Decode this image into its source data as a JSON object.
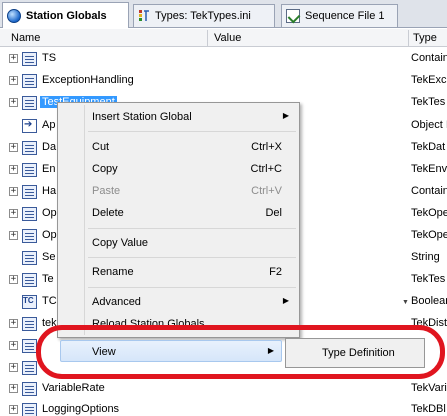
{
  "tabs": [
    {
      "label": "Station Globals",
      "icon": "globe-icon"
    },
    {
      "label": "Types: TekTypes.ini",
      "icon": "types-icon"
    },
    {
      "label": "Sequence File 1",
      "icon": "sequence-file-icon"
    }
  ],
  "columns": {
    "name": "Name",
    "value": "Value",
    "type": "Type"
  },
  "rows": [
    {
      "name": "TS",
      "type": "Contain"
    },
    {
      "name": "ExceptionHandling",
      "type": "TekExc"
    },
    {
      "name": "TestEquipment",
      "type": "TekTes"
    },
    {
      "name": "Ap",
      "type": "Object I"
    },
    {
      "name": "Da",
      "type": "TekDat"
    },
    {
      "name": "En",
      "type": "TekEnv"
    },
    {
      "name": "Ha",
      "type": "Contain"
    },
    {
      "name": "Op",
      "type": "TekOpe"
    },
    {
      "name": "Op",
      "type": "TekOpe"
    },
    {
      "name": "Se",
      "type": "String"
    },
    {
      "name": "Te",
      "type": "TekTes"
    },
    {
      "name": "TC",
      "type": "Boolear"
    },
    {
      "name": "tek",
      "type": "TekDist"
    },
    {
      "name": "",
      "type": ""
    },
    {
      "name": "",
      "type": ""
    },
    {
      "name": "VariableRate",
      "type": "TekVari"
    },
    {
      "name": "LoggingOptions",
      "type": "TekDBl"
    }
  ],
  "context_menu": {
    "insert": "Insert Station Global",
    "cut": "Cut",
    "cut_sc": "Ctrl+X",
    "copy": "Copy",
    "copy_sc": "Ctrl+C",
    "paste": "Paste",
    "paste_sc": "Ctrl+V",
    "delete": "Delete",
    "delete_sc": "Del",
    "copy_value": "Copy Value",
    "rename": "Rename",
    "rename_sc": "F2",
    "advanced": "Advanced",
    "reload": "Reload Station Globals",
    "view": "View"
  },
  "submenu": {
    "type_definition": "Type Definition"
  },
  "colors": {
    "selection": "#3399ff",
    "annotation": "#e0151f"
  }
}
